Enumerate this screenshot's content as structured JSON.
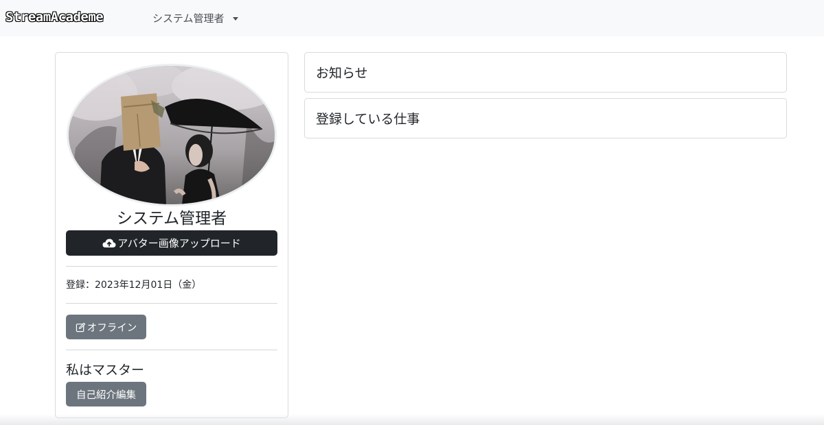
{
  "navbar": {
    "brand": "StreamAcademe",
    "user_menu_label": "システム管理者"
  },
  "profile": {
    "name": "システム管理者",
    "upload_button_label": "アバター画像アップロード",
    "registration_text": "登録：2023年12月01日（金）",
    "status_button_label": "オフライン",
    "bio_text": "私はマスター",
    "bio_edit_button_label": "自己紹介編集"
  },
  "panels": {
    "news_title": "お知らせ",
    "jobs_title": "登録している仕事"
  },
  "icons": {
    "upload": "cloud-upload-icon",
    "status": "edit-icon",
    "menu": "caret-down-icon"
  },
  "colors": {
    "navbar_bg": "#f8f9fa",
    "dark_button": "#212529",
    "secondary_button": "#6c757d",
    "border": "#d7dadd"
  }
}
